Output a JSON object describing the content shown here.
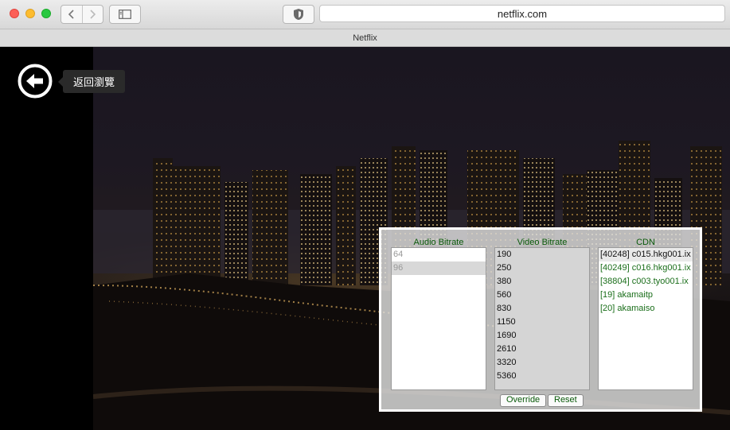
{
  "browser": {
    "url": "netflix.com",
    "tab_title": "Netflix"
  },
  "player": {
    "back_tooltip": "返回瀏覽"
  },
  "stream_panel": {
    "audio": {
      "header": "Audio Bitrate",
      "items": [
        "64",
        "96"
      ],
      "selected_index": 1
    },
    "video": {
      "header": "Video Bitrate",
      "items": [
        "190",
        "250",
        "380",
        "560",
        "830",
        "1150",
        "1690",
        "2610",
        "3320",
        "5360"
      ]
    },
    "cdn": {
      "header": "CDN",
      "items": [
        "[40248] c015.hkg001.ix",
        "[40249] c016.hkg001.ix",
        "[38804] c003.tyo001.ix",
        "[19] akamaitp",
        "[20] akamaiso"
      ],
      "selected_index": 0
    },
    "override_label": "Override",
    "reset_label": "Reset"
  }
}
